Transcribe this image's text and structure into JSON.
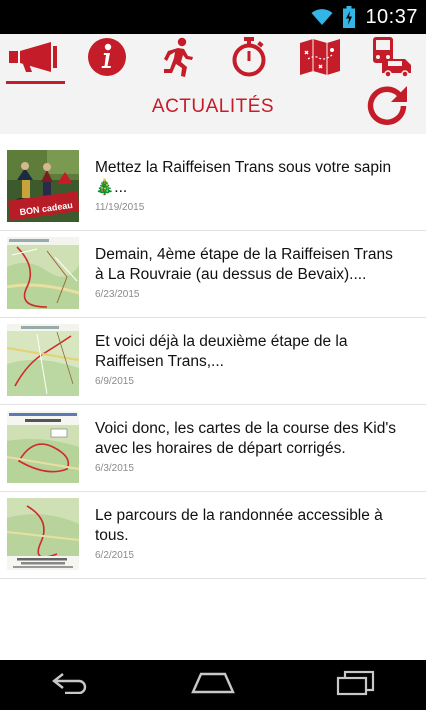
{
  "status_bar": {
    "time": "10:37",
    "icons": [
      "wifi-icon",
      "battery-charging-icon"
    ]
  },
  "nav_tabs": [
    {
      "name": "news",
      "icon": "megaphone-icon",
      "active": true
    },
    {
      "name": "info",
      "icon": "info-icon",
      "active": false
    },
    {
      "name": "race",
      "icon": "runner-icon",
      "active": false
    },
    {
      "name": "timing",
      "icon": "stopwatch-icon",
      "active": false
    },
    {
      "name": "map",
      "icon": "map-icon",
      "active": false
    },
    {
      "name": "transport",
      "icon": "transport-icon",
      "active": false
    }
  ],
  "header": {
    "title": "ACTUALITÉS",
    "refresh_icon": "refresh-icon"
  },
  "news": [
    {
      "title": "Mettez la Raiffeisen Trans sous votre sapin 🎄...",
      "date": "11/19/2015",
      "thumb_label": "BON cadeau"
    },
    {
      "title": "Demain, 4ème étape de la Raiffeisen Trans à La Rouvraie (au dessus de Bevaix)....",
      "date": "6/23/2015"
    },
    {
      "title": "Et voici déjà la deuxième étape de la Raiffeisen Trans,...",
      "date": "6/9/2015"
    },
    {
      "title": "Voici donc, les cartes de la course des Kid's avec les horaires de départ corrigés.",
      "date": "6/3/2015"
    },
    {
      "title": "Le parcours de la randonnée accessible à tous.",
      "date": "6/2/2015"
    }
  ],
  "system_nav": [
    "back-icon",
    "home-icon",
    "recents-icon"
  ],
  "colors": {
    "accent": "#c41c28",
    "toolbar_bg": "#f3f3f3",
    "date_text": "#8a8a8a",
    "status_accent": "#33b5e5"
  }
}
